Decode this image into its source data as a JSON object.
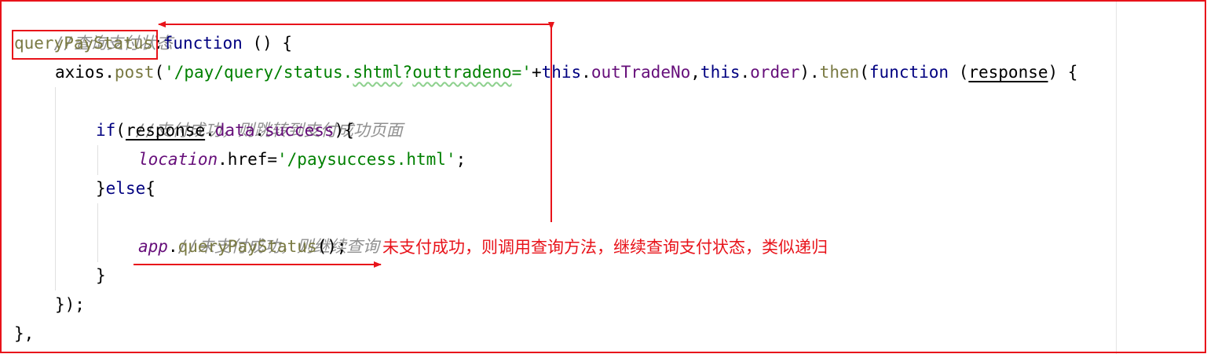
{
  "code": {
    "comment_title": "//查询支付状态",
    "method_name": "queryPayStatus",
    "colon": ":",
    "kw_function": "function",
    "signature_tail": " () {",
    "axios": "axios",
    "dot": ".",
    "post": "post",
    "open_paren": "(",
    "url_str": "'/pay/query/status.",
    "url_shtml": "shtml",
    "url_q": "?",
    "url_param": "outtradeno",
    "url_end": "='",
    "plus": "+",
    "kw_this": "this",
    "outTradeNo": "outTradeNo",
    "comma": ",",
    "order": "order",
    "close_then": ").",
    "then": "then",
    "space_paren": " (",
    "response": "response",
    "callback_tail": ") {",
    "comment_success": "//支付成功，则跳转到支付成功页面",
    "kw_if": "if",
    "data": "data",
    "success": "success",
    "if_tail": "){",
    "location": "location",
    "href_assign": ".href=",
    "href_str": "'/paysuccess.html'",
    "semicolon": ";",
    "else_close": "}",
    "kw_else": "else",
    "else_open": "{",
    "comment_retry": "//未支付成功，则继续查询",
    "app": "app",
    "call_tail": "();",
    "close_if": "}",
    "close_then_call": "});",
    "close_method": "},"
  },
  "annotation": {
    "note_text": "未支付成功，则调用查询方法，继续查询支付状态，类似递归",
    "color": "#e8131a"
  },
  "colors": {
    "comment": "#909090",
    "keyword": "#000080",
    "string": "#008000",
    "function_call": "#7a7a43",
    "field": "#660e7a"
  }
}
